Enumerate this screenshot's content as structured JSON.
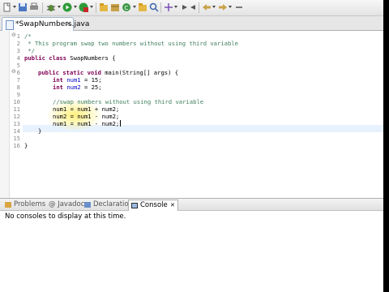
{
  "editor": {
    "tab": {
      "label": "*SwapNumbers.java",
      "close": "✕"
    },
    "line_numbers": [
      "1",
      "2",
      "3",
      "4",
      "5",
      "6",
      "7",
      "8",
      "9",
      "10",
      "11",
      "12",
      "13",
      "14",
      "15",
      "16"
    ],
    "lines": {
      "l1": "/*",
      "l2": " * This program swap two numbers without using third variable",
      "l3": " */",
      "l4_kw": "public class ",
      "l4_rest": "SwapNumbers {",
      "l6_kw": "public static void ",
      "l6_rest": "main(String[] args) {",
      "l7_type": "int ",
      "l7_var": "num1",
      "l7_rest": " = 15;",
      "l8_type": "int ",
      "l8_var": "num2",
      "l8_rest": " = 25;",
      "l10": "//swap numbers without using third variable",
      "l11": "num1 = num1 + num2;",
      "l12": "num2 = num1 - num2;",
      "l13": "num1 = num1 - num2;",
      "l14": "}",
      "l16": "}"
    },
    "fold_markers": [
      "⊖",
      "⊖"
    ]
  },
  "bottom_panel": {
    "tabs": [
      {
        "label": "Problems"
      },
      {
        "label": "@ Javadoc"
      },
      {
        "label": "Declaration"
      },
      {
        "label": "Console",
        "active": true,
        "close": "✕"
      }
    ],
    "message": "No consoles to display at this time."
  },
  "toolbar": {
    "icons": [
      "new-file-icon",
      "save-icon",
      "print-icon",
      "debug-icon",
      "run-icon",
      "external-tools-icon",
      "new-java-project-icon",
      "new-package-icon",
      "new-class-icon",
      "open-type-icon",
      "search-icon",
      "toggle-breadcrumb-icon",
      "next-annotation-icon",
      "previous-annotation-icon",
      "back-icon",
      "forward-icon",
      "pin-editor-icon"
    ]
  },
  "colors": {
    "keyword": "#7f0055",
    "comment": "#3f7f5f",
    "field": "#0000c0",
    "current_line": "#e8f2fe"
  }
}
